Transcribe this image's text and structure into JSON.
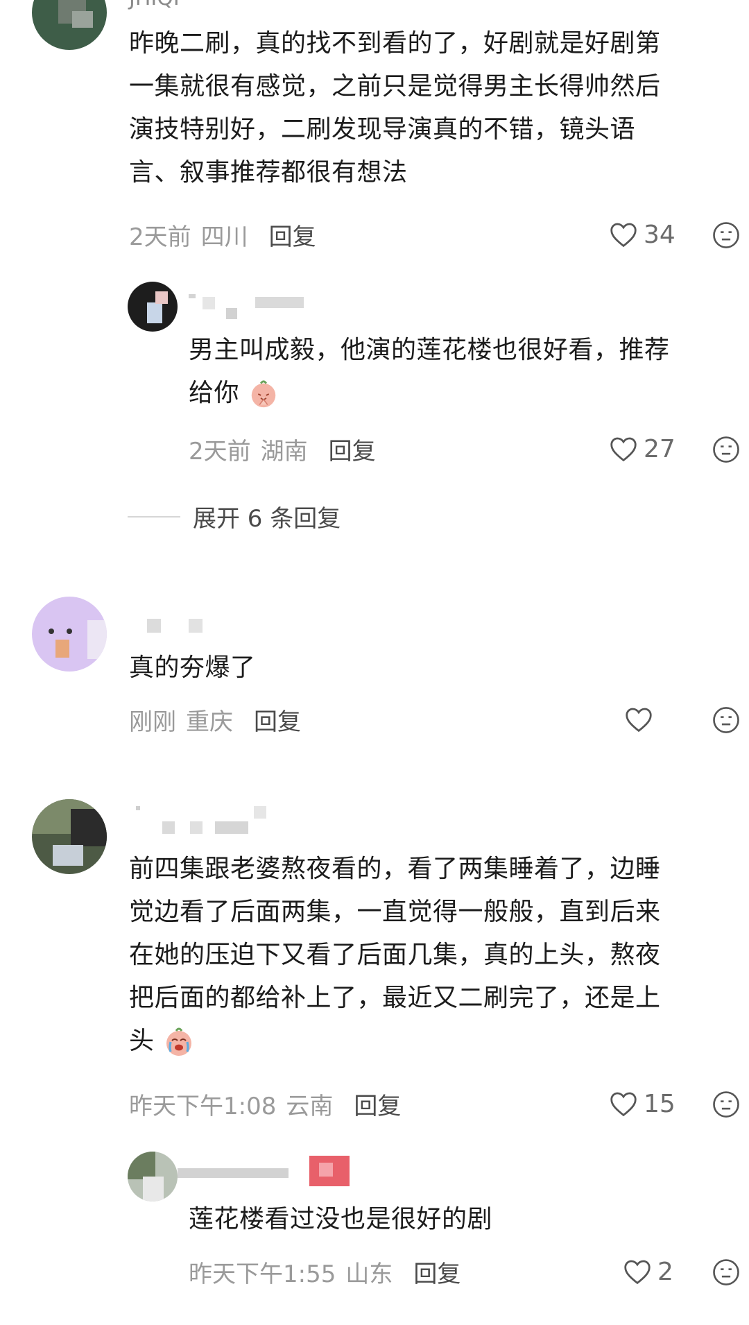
{
  "comments": [
    {
      "name_partial": "JHIQI",
      "text_lines": [
        "昨晚二刷，真的找不到看的了，好剧就是好剧第",
        "一集就很有感觉，之前只是觉得男主长得帅然后",
        "演技特别好，二刷发现导演真的不错，镜头语",
        "言、叙事推荐都很有想法"
      ],
      "time": "2天前",
      "location": "四川",
      "reply_label": "回复",
      "likes": "34",
      "replies": [
        {
          "text_lines": [
            "男主叫成毅，他演的莲花楼也很好看，推荐",
            "给你"
          ],
          "time": "2天前",
          "location": "湖南",
          "reply_label": "回复",
          "likes": "27"
        }
      ],
      "expand_label": "展开 6 条回复"
    },
    {
      "text_lines": [
        "真的夯爆了"
      ],
      "time": "刚刚",
      "location": "重庆",
      "reply_label": "回复",
      "likes": ""
    },
    {
      "text_lines": [
        "前四集跟老婆熬夜看的，看了两集睡着了，边睡",
        "觉边看了后面两集，一直觉得一般般，直到后来",
        "在她的压迫下又看了后面几集，真的上头，熬夜",
        "把后面的都给补上了，最近又二刷完了，还是上",
        "头"
      ],
      "time": "昨天下午1:08",
      "location": "云南",
      "reply_label": "回复",
      "likes": "15",
      "replies": [
        {
          "text_lines": [
            "莲花楼看过没也是很好的剧"
          ],
          "time": "昨天下午1:55",
          "location": "山东",
          "reply_label": "回复",
          "likes": "2"
        }
      ]
    }
  ],
  "icons": {
    "like": "heart-outline-icon",
    "more": "meh-face-icon",
    "emoji_pray": "pray-emoji",
    "emoji_cry": "crying-emoji"
  },
  "colors": {
    "meta_gray": "#9a9a9a",
    "reply_gray": "#4a4a4a",
    "text": "#1c1c1c"
  }
}
